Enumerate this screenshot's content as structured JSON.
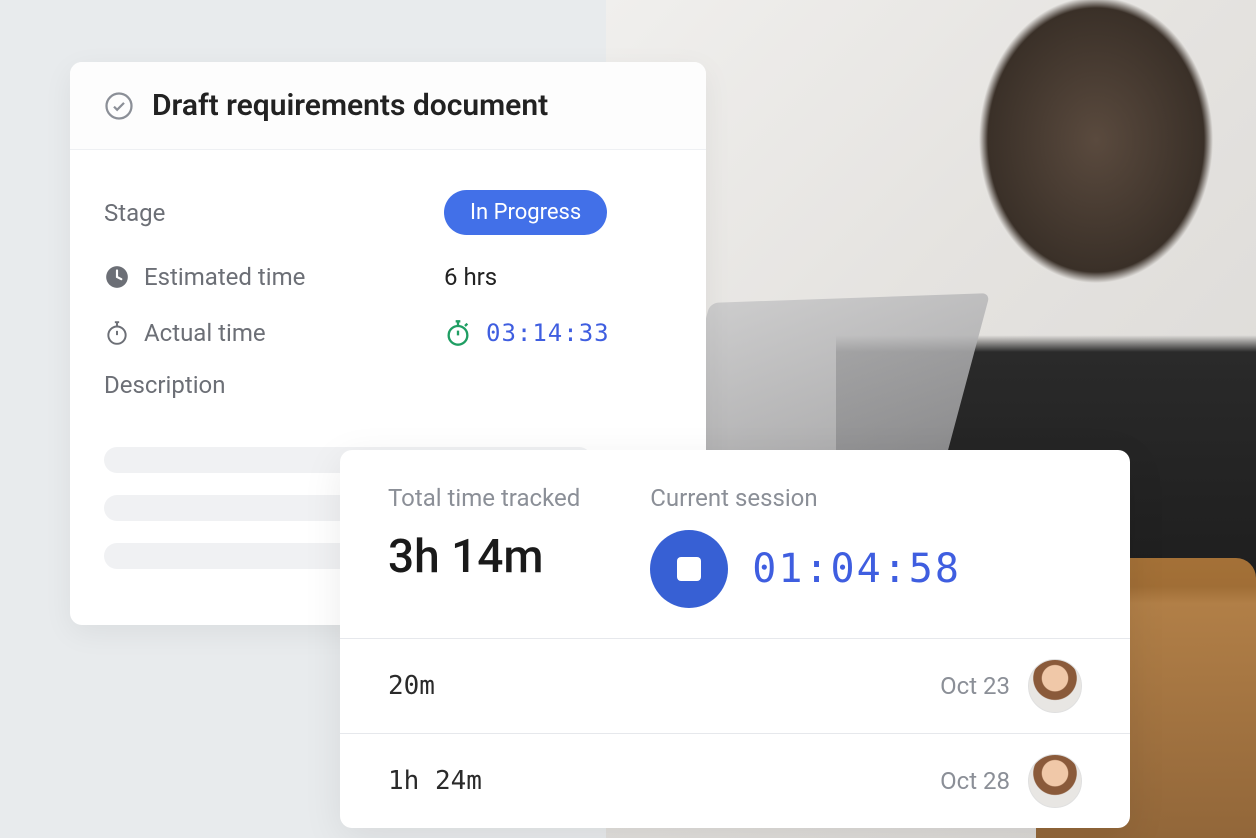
{
  "task": {
    "title": "Draft requirements document",
    "stage_label": "Stage",
    "stage_value": "In Progress",
    "estimated_label": "Estimated time",
    "estimated_value": "6 hrs",
    "actual_label": "Actual time",
    "actual_value": "03:14:33",
    "description_label": "Description"
  },
  "tracker": {
    "total_label": "Total time tracked",
    "total_value": "3h 14m",
    "session_label": "Current session",
    "session_value": "01:04:58",
    "entries": [
      {
        "duration": "20m",
        "date": "Oct 23"
      },
      {
        "duration": "1h 24m",
        "date": "Oct 28"
      }
    ]
  },
  "colors": {
    "accent": "#3760d4",
    "timer": "#3f5ee0",
    "muted": "#8b8f97"
  }
}
